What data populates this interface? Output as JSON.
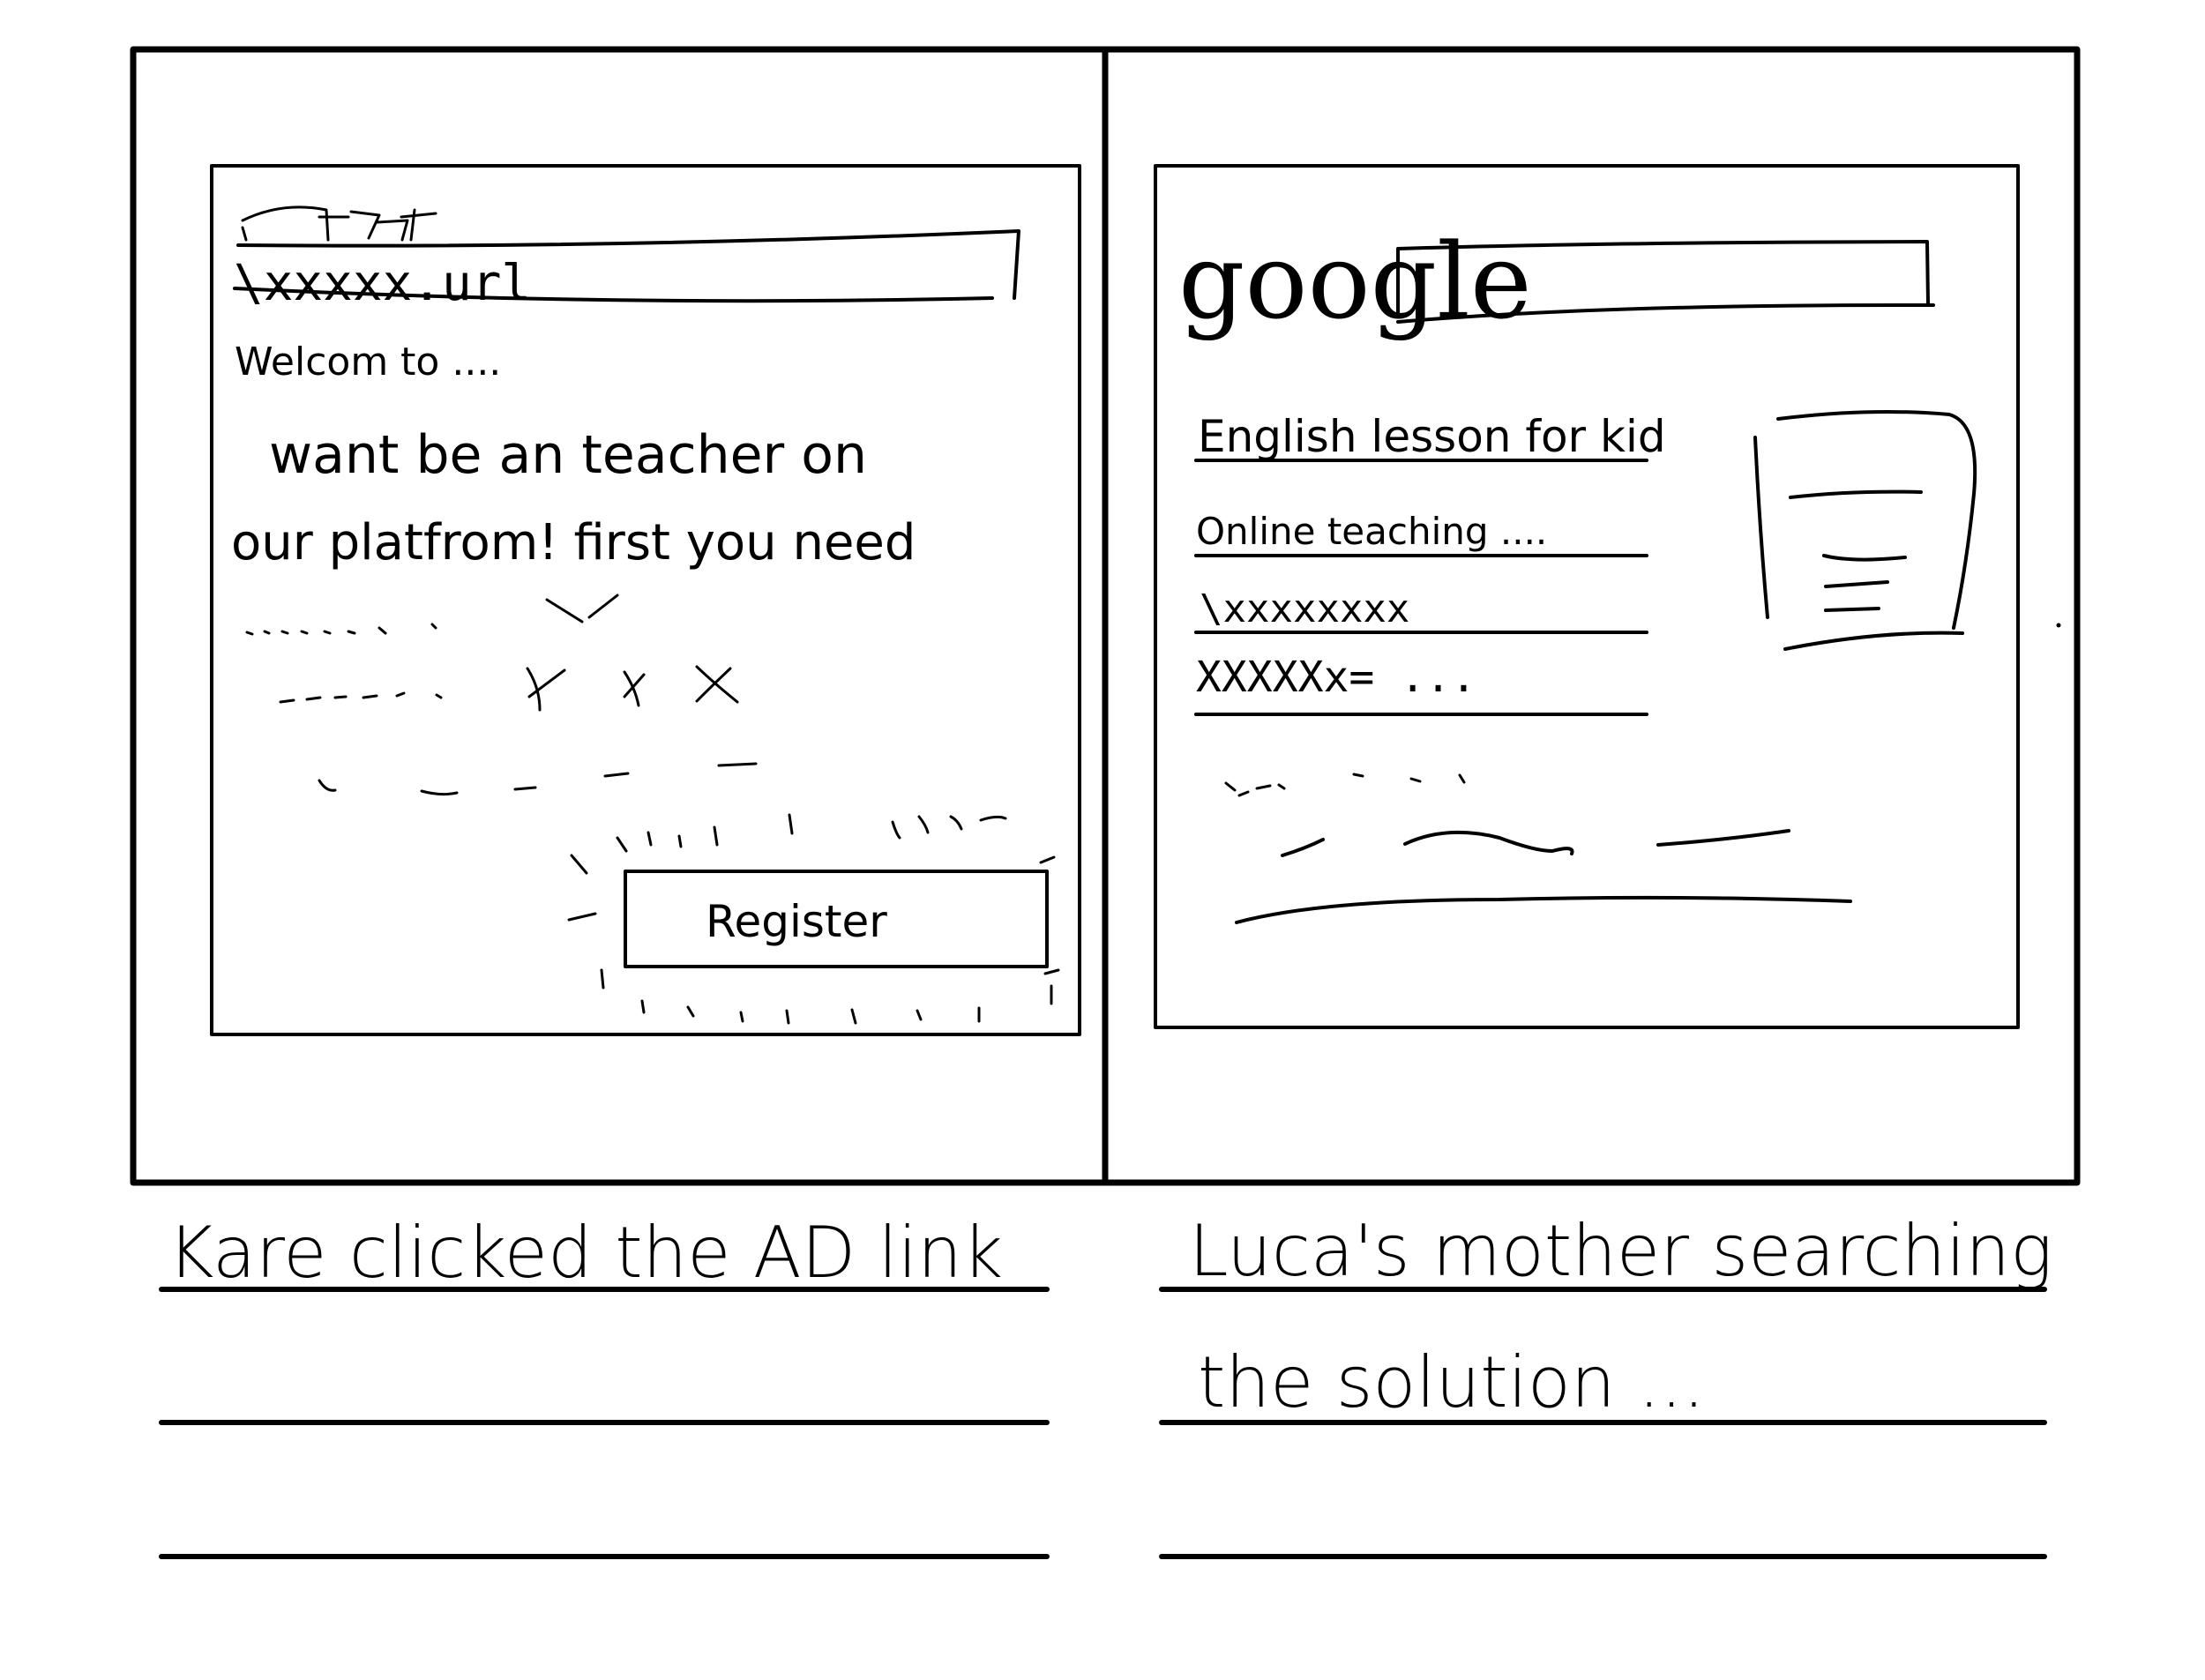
{
  "left_panel": {
    "url_text": "\\xxxxx.url",
    "welcome_text": "Welcom to ....",
    "body_line1": "want be an teacher on",
    "body_line2": "our platfrom! first you need",
    "register_label": "Register",
    "caption": "Kare clicked the AD link"
  },
  "right_panel": {
    "logo_text": "google",
    "results": [
      "English lesson for kid",
      "Online teaching ....",
      "\\xxxxxxxx",
      "XXXXXx= ..."
    ],
    "caption_line1": "Luca's mother searching",
    "caption_line2": "the solution ..."
  }
}
